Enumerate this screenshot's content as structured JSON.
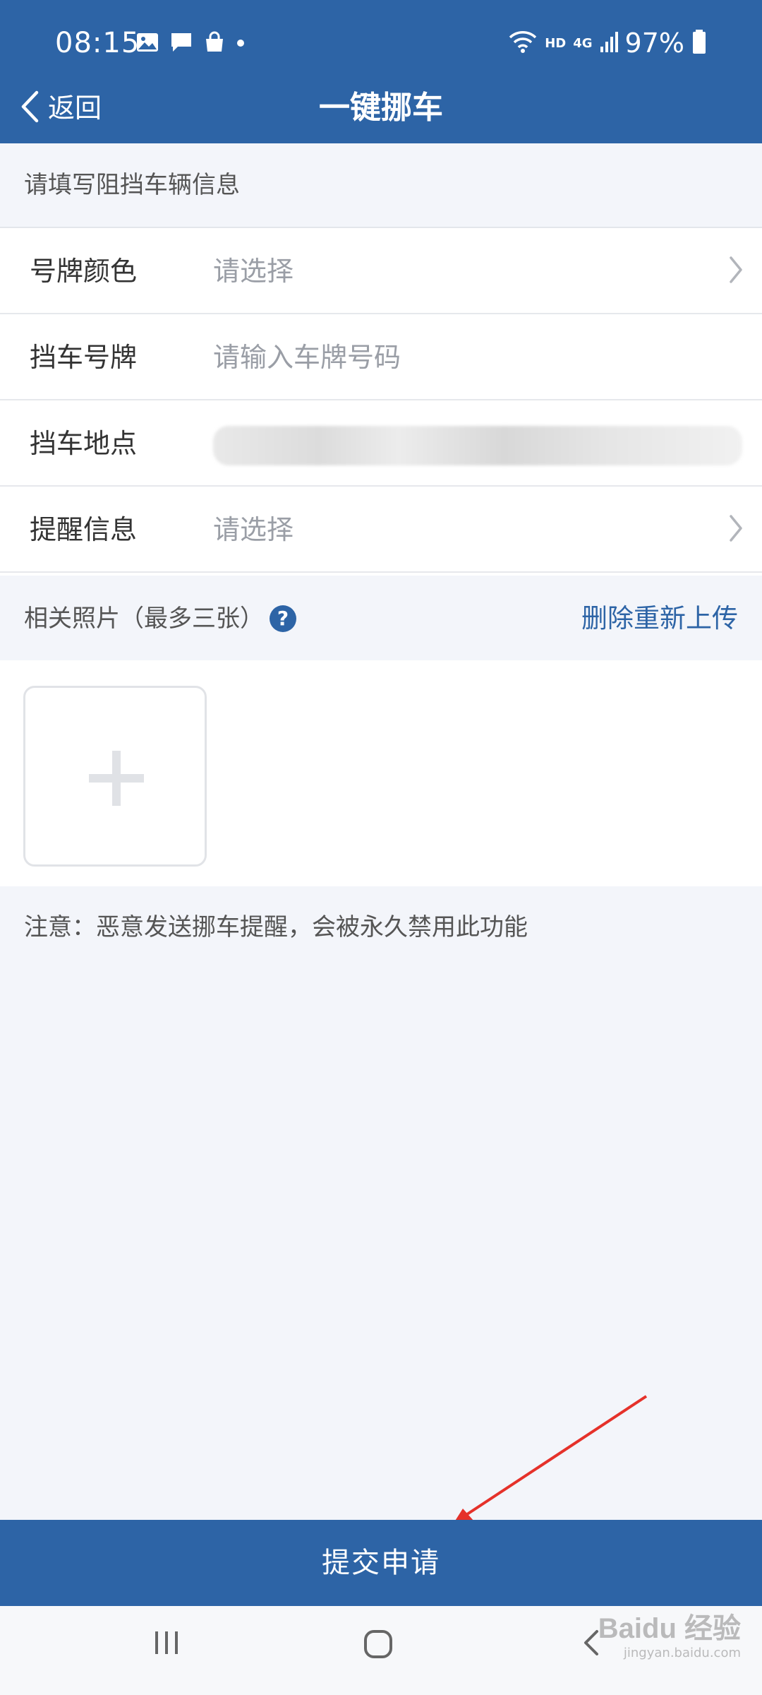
{
  "status_bar": {
    "time": "08:15",
    "network_label": "HD",
    "network_type": "4G",
    "battery": "97%"
  },
  "nav": {
    "back_label": "返回",
    "title": "一键挪车"
  },
  "form": {
    "section_title": "请填写阻挡车辆信息",
    "fields": [
      {
        "label": "号牌颜色",
        "value": "请选择"
      },
      {
        "label": "挡车号牌",
        "placeholder": "请输入车牌号码"
      },
      {
        "label": "挡车地点"
      },
      {
        "label": "提醒信息",
        "value": "请选择"
      }
    ]
  },
  "photos": {
    "title": "相关照片（最多三张）",
    "help_symbol": "?",
    "reupload_label": "删除重新上传"
  },
  "notice": "注意：恶意发送挪车提醒，会被永久禁用此功能",
  "submit_label": "提交申请",
  "watermark": {
    "main": "Baidu 经验",
    "sub": "jingyan.baidu.com"
  },
  "colors": {
    "primary": "#2d64a6",
    "background": "#f3f5fa",
    "annotation": "#e5312a"
  }
}
